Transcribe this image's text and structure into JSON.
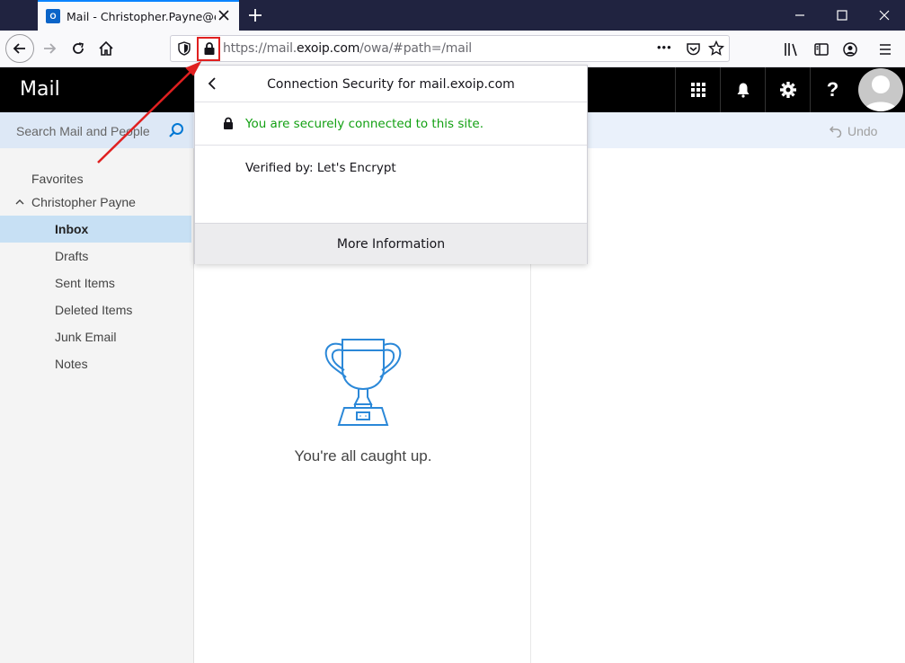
{
  "browser": {
    "tab_title": "Mail - Christopher.Payne@exoip.com",
    "tab_favicon_text": "O",
    "url_prefix": "https://mail.",
    "url_host": "exoip.com",
    "url_path": "/owa/#path=/mail",
    "menu_glyph": "•••"
  },
  "owa": {
    "app_title": "Mail",
    "search_placeholder": "Search Mail and People",
    "undo_label": "Undo",
    "help_glyph": "?"
  },
  "sidebar": {
    "favorites_label": "Favorites",
    "account_label": "Christopher Payne",
    "folders": [
      {
        "label": "Inbox",
        "selected": true
      },
      {
        "label": "Drafts",
        "selected": false
      },
      {
        "label": "Sent Items",
        "selected": false
      },
      {
        "label": "Deleted Items",
        "selected": false
      },
      {
        "label": "Junk Email",
        "selected": false
      },
      {
        "label": "Notes",
        "selected": false
      }
    ]
  },
  "message_list": {
    "empty_text": "You're all caught up."
  },
  "popup": {
    "title": "Connection Security for mail.exoip.com",
    "secure_text": "You are securely connected to this site.",
    "verified_text": "Verified by: Let's Encrypt",
    "more_info_label": "More Information"
  },
  "colors": {
    "accent_blue": "#0078d4",
    "secure_green": "#12a012",
    "annotation_red": "#e02020",
    "selected_folder": "#c7e0f4"
  }
}
